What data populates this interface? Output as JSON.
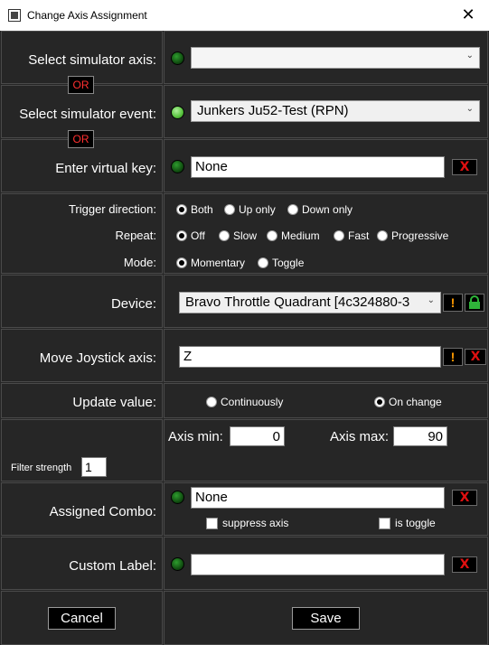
{
  "window": {
    "title": "Change Axis Assignment",
    "close_glyph": "✕"
  },
  "or_label": "OR",
  "clear_glyph": "X",
  "warn_glyph": "!",
  "simulator_axis": {
    "label": "Select simulator axis:",
    "value": ""
  },
  "simulator_event": {
    "label": "Select simulator event:",
    "value": "Junkers Ju52-Test (RPN)"
  },
  "virtual_key": {
    "label": "Enter virtual key:",
    "value": "None"
  },
  "trigger": {
    "direction_label": "Trigger direction:",
    "direction_options": [
      "Both",
      "Up only",
      "Down only"
    ],
    "direction_selected": "Both",
    "repeat_label": "Repeat:",
    "repeat_options": [
      "Off",
      "Slow",
      "Medium",
      "Fast",
      "Progressive"
    ],
    "repeat_selected": "Off",
    "mode_label": "Mode:",
    "mode_options": [
      "Momentary",
      "Toggle"
    ],
    "mode_selected": "Momentary"
  },
  "device": {
    "label": "Device:",
    "value": "Bravo Throttle Quadrant [4c324880-3"
  },
  "joystick_axis": {
    "label": "Move Joystick axis:",
    "value": "Z"
  },
  "update_value": {
    "label": "Update value:",
    "options": [
      "Continuously",
      "On change"
    ],
    "selected": "On change"
  },
  "axis_range": {
    "min_label": "Axis min:",
    "min_value": "0",
    "max_label": "Axis max:",
    "max_value": "90",
    "filter_label": "Filter strength",
    "filter_value": "1"
  },
  "assigned_combo": {
    "label": "Assigned Combo:",
    "value": "None",
    "suppress_label": "suppress axis",
    "toggle_label": "is toggle"
  },
  "custom_label": {
    "label": "Custom Label:",
    "value": ""
  },
  "footer": {
    "cancel_label": "Cancel",
    "save_label": "Save"
  },
  "colors": {
    "panel": "#262626",
    "led_on": "#56c23c",
    "led_off": "#0f4a0f",
    "clear_red": "#e01010",
    "warn_orange": "#ff9a00"
  }
}
